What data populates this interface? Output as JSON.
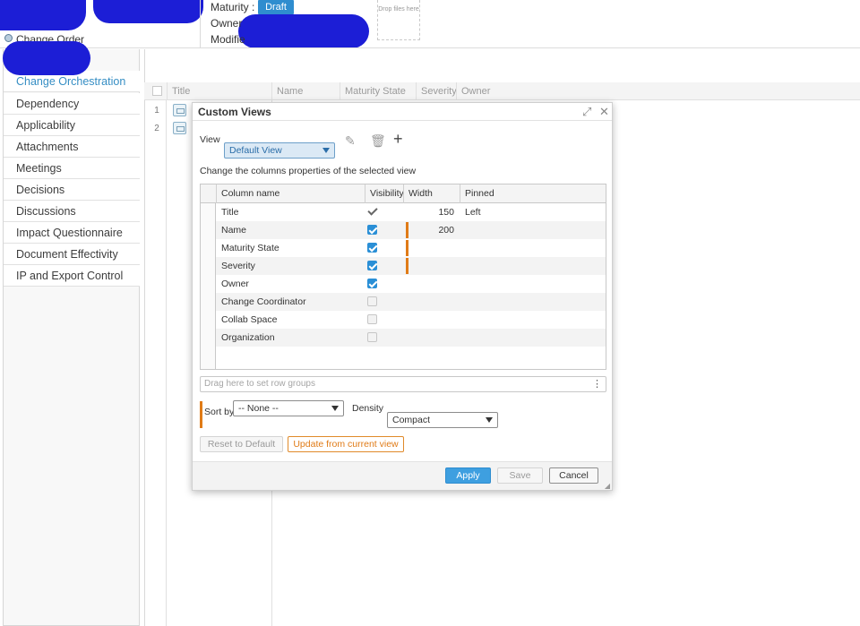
{
  "header": {
    "maturity_label": "Maturity :",
    "maturity_value": "Draft",
    "owner_label": "Owner",
    "modified_label": "Modifie",
    "object_type": "Change Order",
    "drop_text": "Drop files here"
  },
  "sidebar": {
    "items": [
      {
        "label": "Change Orchestration",
        "active": true
      },
      {
        "label": "Dependency"
      },
      {
        "label": "Applicability"
      },
      {
        "label": "Attachments"
      },
      {
        "label": "Meetings"
      },
      {
        "label": "Decisions"
      },
      {
        "label": "Discussions"
      },
      {
        "label": "Impact Questionnaire"
      },
      {
        "label": "Document Effectivity"
      },
      {
        "label": "IP and Export Control"
      }
    ]
  },
  "grid": {
    "columns": [
      "Title",
      "Name",
      "Maturity State",
      "Severity",
      "Owner"
    ],
    "rows": [
      "1",
      "2"
    ]
  },
  "dialog": {
    "title": "Custom Views",
    "view_label": "View",
    "view_value": "Default View",
    "instructions": "Change the columns properties of the selected view",
    "table_headers": {
      "column_name": "Column name",
      "visibility": "Visibility",
      "width": "Width",
      "pinned": "Pinned"
    },
    "columns": [
      {
        "name": "Title",
        "visibility": "locked",
        "width": "150",
        "pinned": "Left"
      },
      {
        "name": "Name",
        "visibility": "on",
        "width": "200",
        "pinned": ""
      },
      {
        "name": "Maturity State",
        "visibility": "on",
        "width": "",
        "pinned": ""
      },
      {
        "name": "Severity",
        "visibility": "on",
        "width": "",
        "pinned": ""
      },
      {
        "name": "Owner",
        "visibility": "on",
        "width": "",
        "pinned": ""
      },
      {
        "name": "Change Coordinator",
        "visibility": "off",
        "width": "",
        "pinned": ""
      },
      {
        "name": "Collab Space",
        "visibility": "off",
        "width": "",
        "pinned": ""
      },
      {
        "name": "Organization",
        "visibility": "off",
        "width": "",
        "pinned": ""
      }
    ],
    "row_groups_placeholder": "Drag here to set row groups",
    "sort_label": "Sort by",
    "sort_value": "-- None --",
    "density_label": "Density",
    "density_value": "Compact",
    "reset_label": "Reset to Default",
    "update_label": "Update from current view",
    "apply_label": "Apply",
    "save_label": "Save",
    "cancel_label": "Cancel"
  },
  "colors": {
    "accent": "#3e9fe0",
    "highlight": "#e07b17",
    "redaction": "#1c1ed6"
  }
}
